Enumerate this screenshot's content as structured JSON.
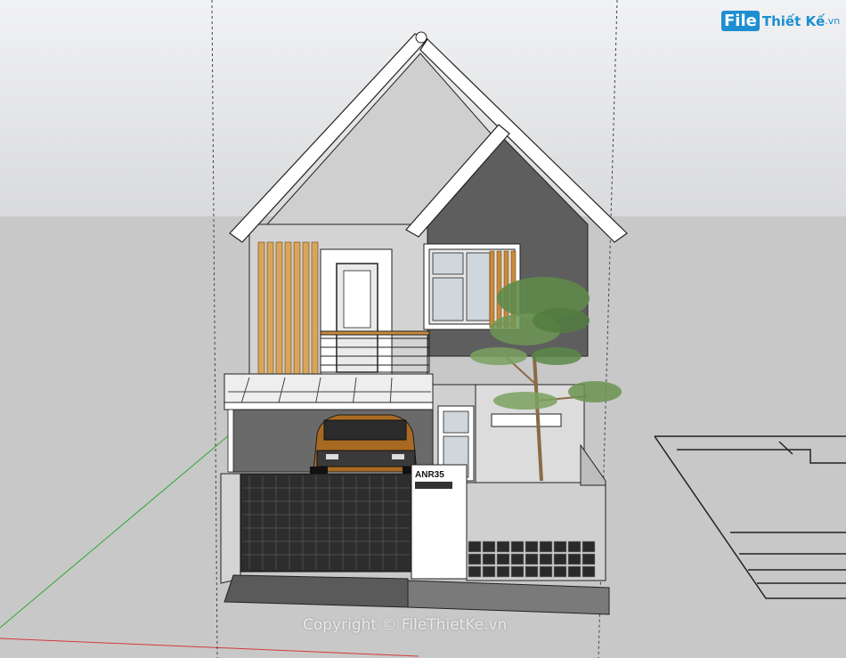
{
  "brand": {
    "logo_mark": "File",
    "logo_name": "Thiết Kế",
    "logo_tld": ".vn",
    "colors": {
      "brand_blue": "#1d8fd1"
    }
  },
  "model": {
    "house_number": "ANR35"
  },
  "watermark": {
    "text": "Copyright © FileThietKe.vn"
  },
  "scene": {
    "axis_colors": {
      "green": "#2ea82e",
      "red": "#d23a3a",
      "blue_guide": "#6e6e6e"
    },
    "icons": [
      "tree-icon",
      "car-icon",
      "logo-mark"
    ]
  }
}
